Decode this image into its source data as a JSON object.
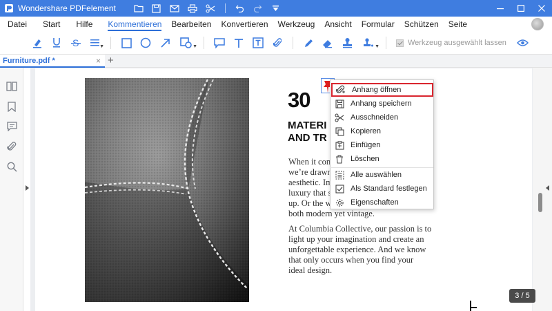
{
  "app": {
    "title": "Wondershare PDFelement"
  },
  "menu": {
    "items": [
      "Datei",
      "Start",
      "Hilfe",
      "Kommentieren",
      "Bearbeiten",
      "Konvertieren",
      "Werkzeug",
      "Ansicht",
      "Formular",
      "Schützen",
      "Seite"
    ],
    "active": "Kommentieren"
  },
  "toolbar": {
    "keep_tool_label": "Werkzeug ausgewählt lassen",
    "keep_tool_checked": true
  },
  "tabs": {
    "active_label": "Furniture.pdf *",
    "close_glyph": "×",
    "add_glyph": "+"
  },
  "document": {
    "heading_number": "30",
    "heading_line1": "MATERI",
    "heading_line2": "AND TR",
    "para1": [
      "When it com",
      "we’re drawn t",
      "aesthetic. Ima",
      "luxury that su",
      "up. Or the wa",
      "both modern yet vintage."
    ],
    "para2": [
      "At Columbia Collective, our passion is to",
      "light up your imagination and create an",
      "unforgettable experience. And we know",
      "that only occurs when you find your",
      "ideal design."
    ]
  },
  "page_indicator": "3 / 5",
  "context_menu": {
    "items": [
      {
        "label": "Anhang öffnen",
        "icon": "paperclip-open-icon",
        "highlighted": true
      },
      {
        "label": "Anhang speichern",
        "icon": "save-icon"
      },
      {
        "label": "Ausschneiden",
        "icon": "scissors-icon"
      },
      {
        "label": "Kopieren",
        "icon": "copy-icon"
      },
      {
        "label": "Einfügen",
        "icon": "paste-icon"
      },
      {
        "label": "Löschen",
        "icon": "trash-icon"
      },
      {
        "label": "Alle auswählen",
        "icon": "select-all-icon"
      },
      {
        "label": "Als Standard festlegen",
        "icon": "checkbox-icon"
      },
      {
        "label": "Eigenschaften",
        "icon": "gear-icon"
      }
    ]
  },
  "colors": {
    "titlebar": "#3f7de0",
    "accent": "#2d6fd8",
    "highlight_border": "#d9262f",
    "pin_red": "#e02020"
  }
}
